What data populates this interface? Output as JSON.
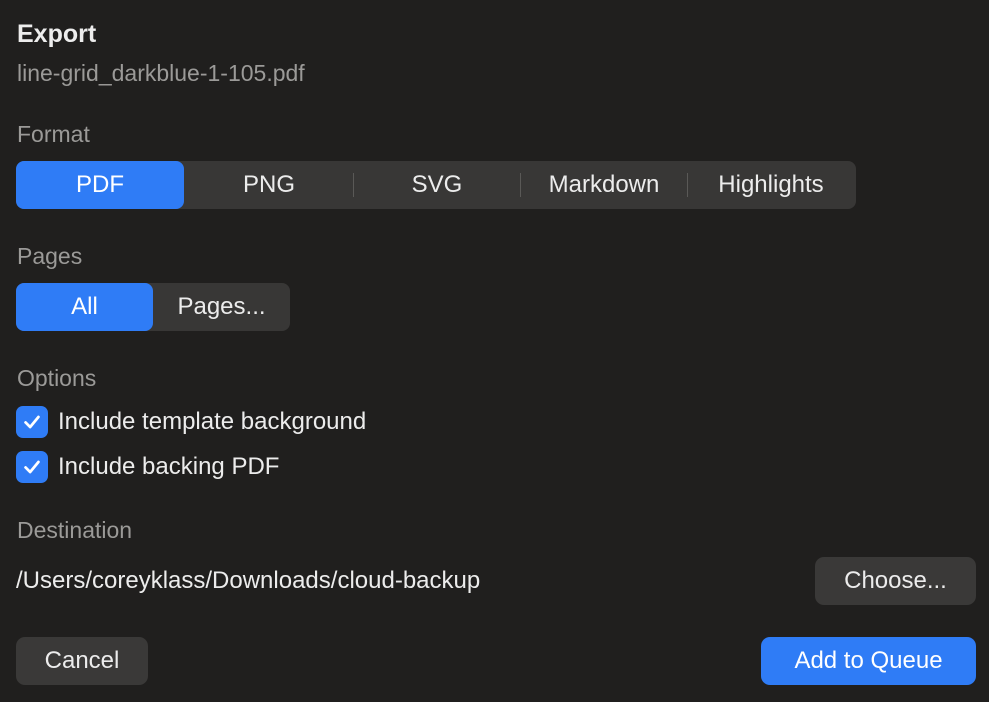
{
  "header": {
    "title": "Export",
    "filename": "line-grid_darkblue-1-105.pdf"
  },
  "format": {
    "label": "Format",
    "options": [
      "PDF",
      "PNG",
      "SVG",
      "Markdown",
      "Highlights"
    ],
    "selected": "PDF"
  },
  "pages": {
    "label": "Pages",
    "options": [
      "All",
      "Pages..."
    ],
    "selected": "All"
  },
  "options": {
    "label": "Options",
    "items": [
      {
        "label": "Include template background",
        "checked": true
      },
      {
        "label": "Include backing PDF",
        "checked": true
      }
    ]
  },
  "destination": {
    "label": "Destination",
    "path": "/Users/coreyklass/Downloads/cloud-backup",
    "choose_label": "Choose..."
  },
  "footer": {
    "cancel_label": "Cancel",
    "add_label": "Add to Queue"
  },
  "colors": {
    "background": "#201f1e",
    "accent": "#2f7cf6",
    "control": "#383736",
    "secondary_text": "#9b9a98"
  }
}
